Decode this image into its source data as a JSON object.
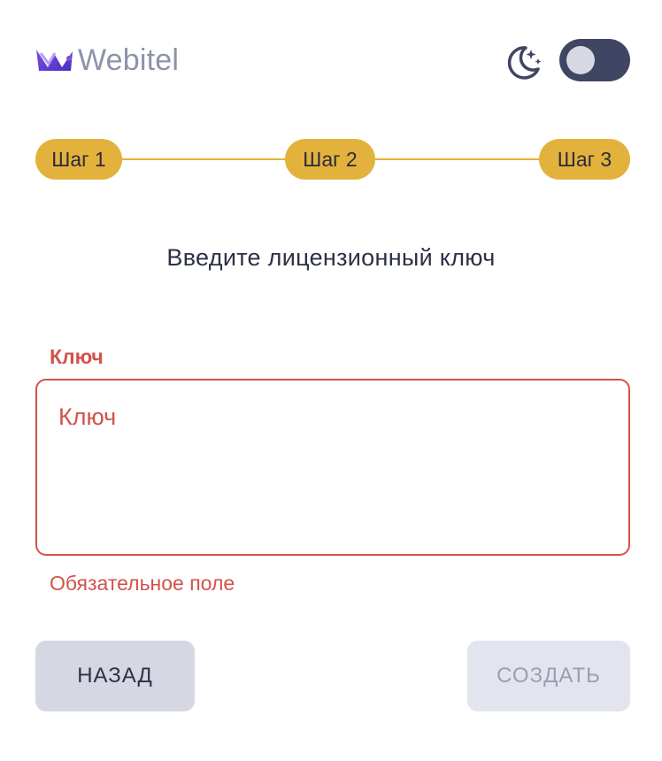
{
  "header": {
    "logo_text": "Webitel",
    "theme_icon": "moon-stars-icon",
    "theme_toggle": {
      "state": "off"
    }
  },
  "stepper": {
    "steps": [
      {
        "label": "Шаг 1"
      },
      {
        "label": "Шаг 2"
      },
      {
        "label": "Шаг 3"
      }
    ],
    "accent_color": "#e3b23c"
  },
  "main": {
    "heading": "Введите лицензионный ключ",
    "key_field": {
      "label": "Ключ",
      "placeholder": "Ключ",
      "value": "",
      "error": "Обязательное поле",
      "error_color": "#d2524a"
    }
  },
  "actions": {
    "back_label": "Назад",
    "create_label": "Создать",
    "create_enabled": false
  },
  "colors": {
    "brand_text": "#8e93ab",
    "toggle_bg": "#3f4563"
  }
}
